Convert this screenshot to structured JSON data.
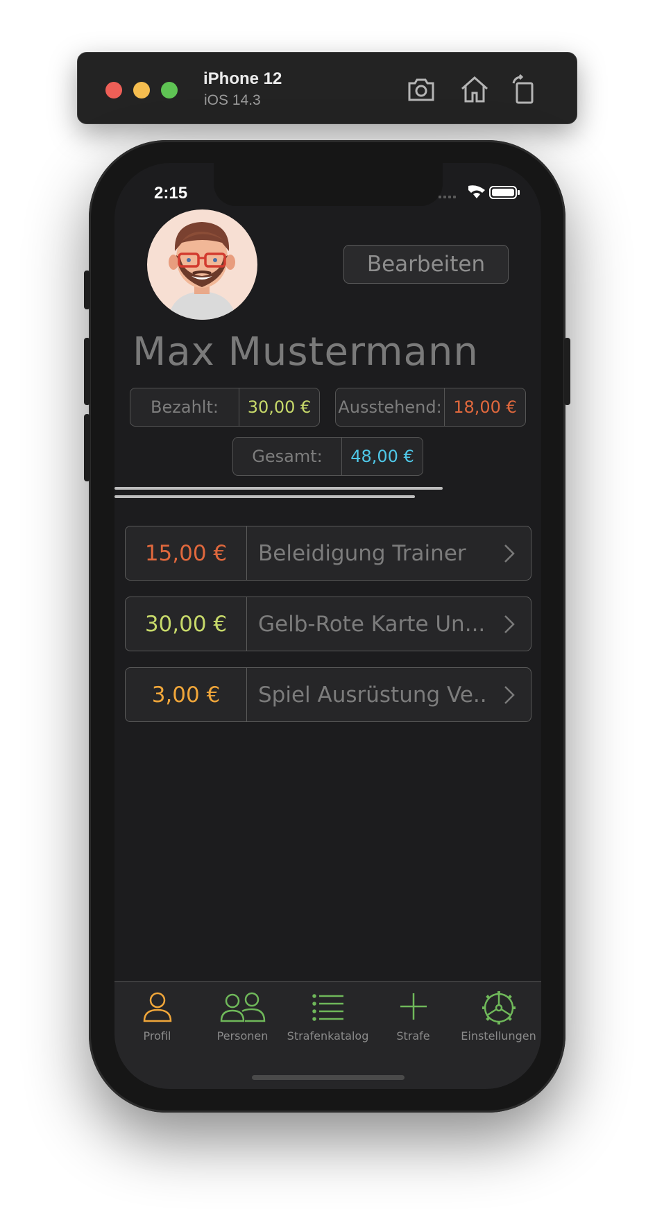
{
  "simulator": {
    "device": "iPhone 12",
    "os": "iOS 14.3",
    "icons": [
      "screenshot-icon",
      "home-icon",
      "rotate-icon"
    ]
  },
  "status_bar": {
    "time": "2:15",
    "icons": [
      "signal-icon",
      "wifi-icon",
      "battery-icon"
    ]
  },
  "profile": {
    "name": "Max Mustermann",
    "edit_label": "Bearbeiten",
    "paid_label": "Bezahlt:",
    "paid_value": "30,00 €",
    "outstanding_label": "Ausstehend:",
    "outstanding_value": "18,00 €",
    "total_label": "Gesamt:",
    "total_value": "48,00 €"
  },
  "fines": [
    {
      "amount": "15,00 €",
      "reason": "Beleidigung Trainer",
      "color": "#e0683d"
    },
    {
      "amount": "30,00 €",
      "reason": "Gelb-Rote Karte Un...",
      "color": "#c7d96a"
    },
    {
      "amount": "3,00 €",
      "reason": "Spiel Ausrüstung Ve...",
      "color": "#f0a63a"
    }
  ],
  "colors": {
    "paid": "#c7d96a",
    "outstanding": "#e0683d",
    "total": "#4fc8e8",
    "tab_active": "#f0a63a",
    "tab_inactive": "#6fb85a"
  },
  "tabbar": {
    "tabs": [
      {
        "label": "Profil",
        "icon": "person-icon",
        "active": true
      },
      {
        "label": "Personen",
        "icon": "people-icon",
        "active": false
      },
      {
        "label": "Strafenkatalog",
        "icon": "list-icon",
        "active": false
      },
      {
        "label": "Strafe",
        "icon": "plus-icon",
        "active": false
      },
      {
        "label": "Einstellungen",
        "icon": "settings-icon",
        "active": false
      }
    ]
  }
}
